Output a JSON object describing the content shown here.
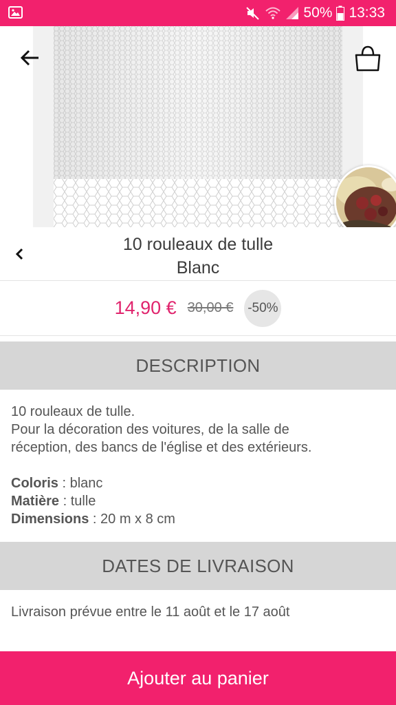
{
  "status_bar": {
    "battery": "50%",
    "time": "13:33"
  },
  "product": {
    "title_line1": "10 rouleaux de tulle",
    "title_line2": "Blanc",
    "price": "14,90 €",
    "old_price": "30,00 €",
    "discount": "-50%"
  },
  "description": {
    "header": "DESCRIPTION",
    "line1": "10 rouleaux de tulle.",
    "line2": "Pour la décoration des voitures, de la salle de",
    "line3": "réception, des bancs de l'église et des extérieurs.",
    "specs": [
      {
        "label": "Coloris",
        "value": " : blanc"
      },
      {
        "label": "Matière",
        "value": " : tulle"
      },
      {
        "label": "Dimensions",
        "value": " : 20 m x 8 cm"
      }
    ]
  },
  "delivery": {
    "header": "DATES DE LIVRAISON",
    "text": "Livraison prévue entre le 11 août et le 17 août"
  },
  "add_to_cart_label": "Ajouter au panier",
  "colors": {
    "accent": "#f2216d",
    "price": "#e0246d",
    "section_bg": "#d6d6d6"
  }
}
